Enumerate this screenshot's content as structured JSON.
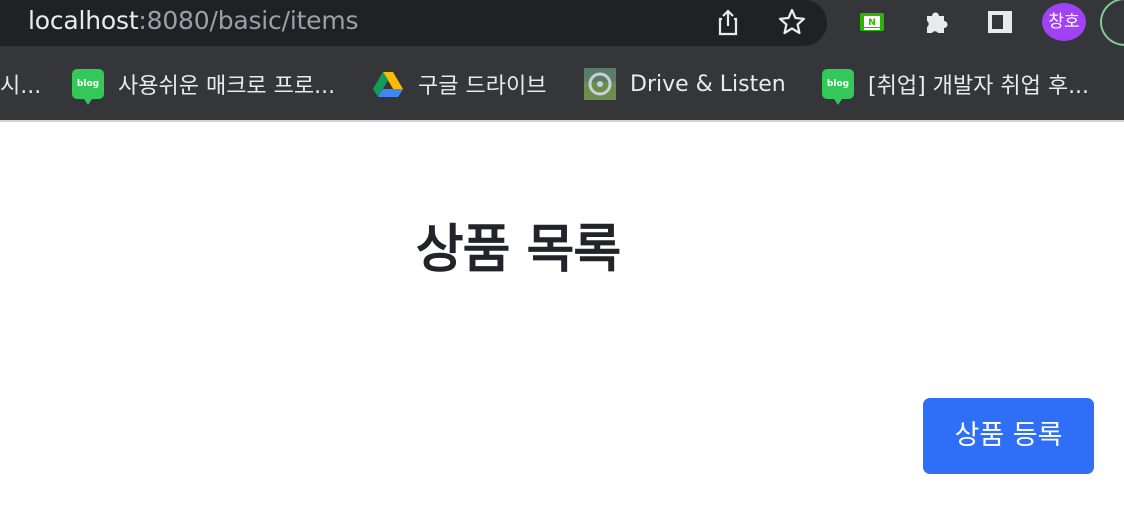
{
  "browser": {
    "url_host": "localhost",
    "url_rest": ":8080/basic/items",
    "profile_initials": "창호",
    "extension_badge": "N",
    "icons": [
      "info-icon",
      "share-icon",
      "star-icon",
      "extension-n-icon",
      "puzzle-icon",
      "sidepanel-icon"
    ]
  },
  "bookmarks": [
    {
      "label": "시...",
      "icon": "none"
    },
    {
      "label": "사용쉬운 매크로 프로...",
      "icon": "blog-icon",
      "icon_text": "blog"
    },
    {
      "label": "구글 드라이브",
      "icon": "google-drive-icon"
    },
    {
      "label": "Drive & Listen",
      "icon": "drive-listen-icon"
    },
    {
      "label": "[취업] 개발자 취업 후...",
      "icon": "blog-icon",
      "icon_text": "blog"
    }
  ],
  "page": {
    "title": "상품 목록",
    "add_button_label": "상품 등록"
  },
  "colors": {
    "chrome_bg": "#35363a",
    "omnibox_bg": "#202124",
    "primary_button": "#2f6ef7",
    "title_text": "#212529",
    "avatar_bg": "#a142f4"
  }
}
